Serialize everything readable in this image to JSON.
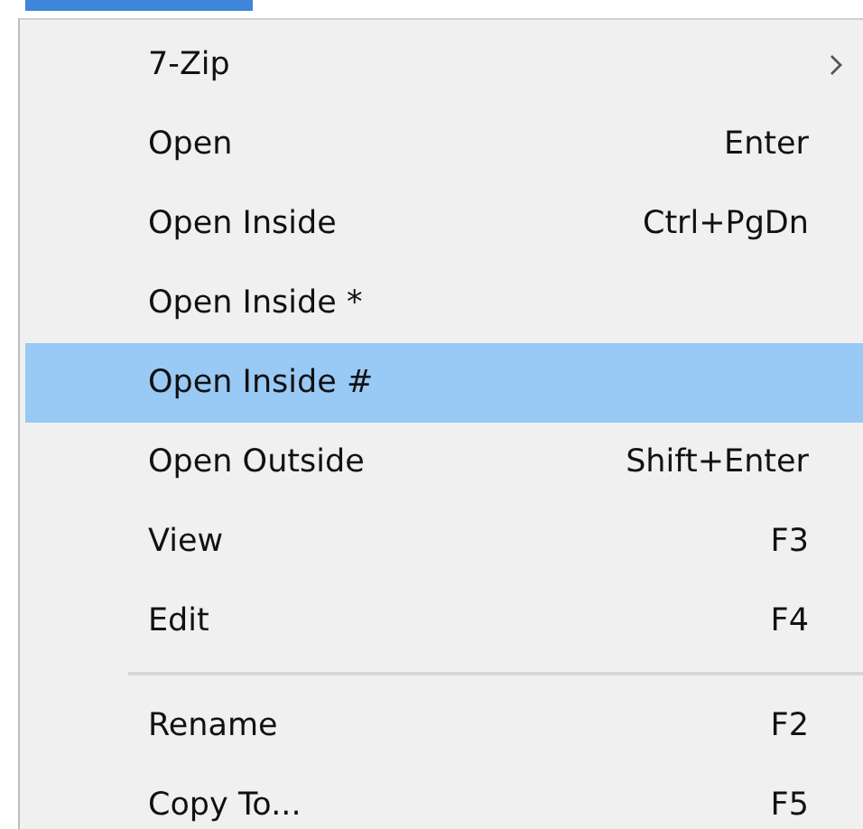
{
  "menu": {
    "items": [
      {
        "kind": "item",
        "label": "7-Zip",
        "submenu": true,
        "selected": false
      },
      {
        "kind": "item",
        "label": "Open",
        "shortcut": "Enter",
        "submenu": false,
        "selected": false
      },
      {
        "kind": "item",
        "label": "Open Inside",
        "shortcut": "Ctrl+PgDn",
        "submenu": false,
        "selected": false
      },
      {
        "kind": "item",
        "label": "Open Inside *",
        "submenu": false,
        "selected": false
      },
      {
        "kind": "item",
        "label": "Open Inside #",
        "submenu": false,
        "selected": true
      },
      {
        "kind": "item",
        "label": "Open Outside",
        "shortcut": "Shift+Enter",
        "submenu": false,
        "selected": false
      },
      {
        "kind": "item",
        "label": "View",
        "shortcut": "F3",
        "submenu": false,
        "selected": false
      },
      {
        "kind": "item",
        "label": "Edit",
        "shortcut": "F4",
        "submenu": false,
        "selected": false
      },
      {
        "kind": "separator"
      },
      {
        "kind": "item",
        "label": "Rename",
        "shortcut": "F2",
        "submenu": false,
        "selected": false
      },
      {
        "kind": "item",
        "label": "Copy To...",
        "shortcut": "F5",
        "submenu": false,
        "selected": false
      }
    ]
  }
}
